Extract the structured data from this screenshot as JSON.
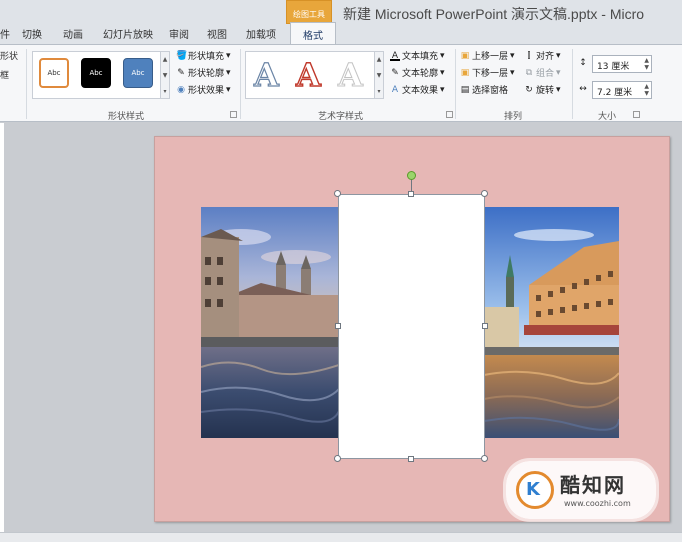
{
  "window": {
    "title": "新建 Microsoft PowerPoint 演示文稿.pptx - Micro"
  },
  "tabs": {
    "cut_left": "件",
    "items": [
      "切换",
      "动画",
      "幻灯片放映",
      "审阅",
      "视图",
      "加载项"
    ],
    "context_group": "绘图工具",
    "active": "格式"
  },
  "ribbon": {
    "left_cut": [
      "形状",
      "框"
    ],
    "shape_styles": {
      "swatches": [
        "Abc",
        "Abc",
        "Abc"
      ],
      "fill": "形状填充",
      "outline": "形状轮廓",
      "effects": "形状效果",
      "label": "形状样式"
    },
    "wordart": {
      "letters": [
        "A",
        "A",
        "A"
      ],
      "text_fill": "文本填充",
      "text_outline": "文本轮廓",
      "text_effects": "文本效果",
      "label": "艺术字样式"
    },
    "arrange": {
      "bring_forward": "上移一层",
      "send_backward": "下移一层",
      "selection_pane": "选择窗格",
      "align": "对齐",
      "group": "组合",
      "rotate": "旋转",
      "label": "排列"
    },
    "size": {
      "height": "13 厘米",
      "width": "7.2 厘米",
      "label": "大小"
    }
  },
  "watermark": {
    "logo_letter": "K",
    "title": "酷知网",
    "url": "www.coozhi.com"
  },
  "colors": {
    "slide_background": "#e6b7b5",
    "accent_orange": "#e8a63b",
    "rotate_handle": "#9bd46a"
  }
}
